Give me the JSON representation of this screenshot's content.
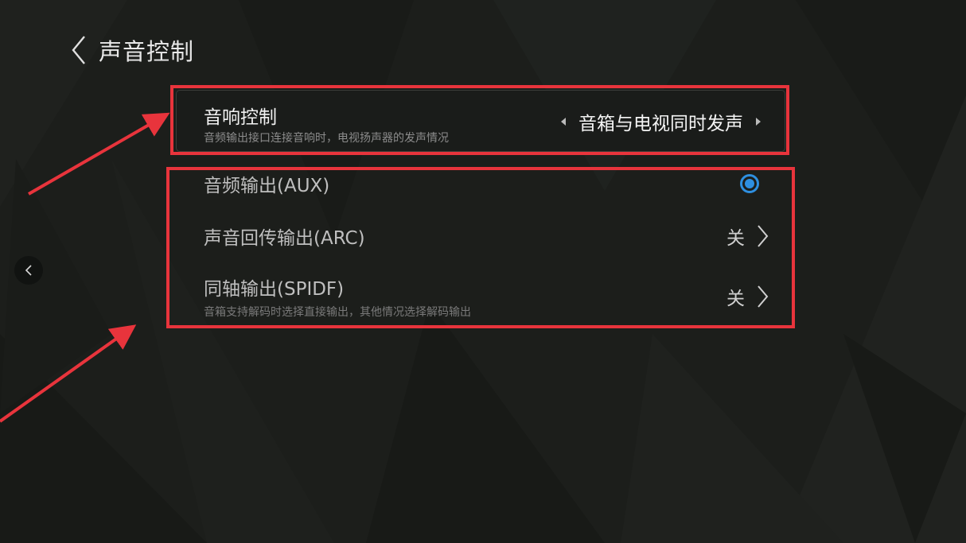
{
  "header": {
    "title": "声音控制"
  },
  "focused_item": {
    "title": "音响控制",
    "description": "音频输出接口连接音响时，电视扬声器的发声情况",
    "value": "音箱与电视同时发声"
  },
  "options": [
    {
      "label": "音频输出(AUX)",
      "subtitle": "",
      "control": "radio",
      "selected": true
    },
    {
      "label": "声音回传输出(ARC)",
      "subtitle": "",
      "control": "link",
      "state": "关"
    },
    {
      "label": "同轴输出(SPIDF)",
      "subtitle": "音箱支持解码时选择直接输出，其他情况选择解码输出",
      "control": "link",
      "state": "关"
    }
  ],
  "colors": {
    "accent": "#2e8fe0",
    "annotation": "#e8343c",
    "background": "#1c1e1b"
  },
  "icons": {
    "back": "chevron-left-icon",
    "side_nav": "chevron-left-icon",
    "row_arrow": "chevron-right-icon",
    "selector_left": "triangle-left-icon",
    "selector_right": "triangle-right-icon"
  }
}
